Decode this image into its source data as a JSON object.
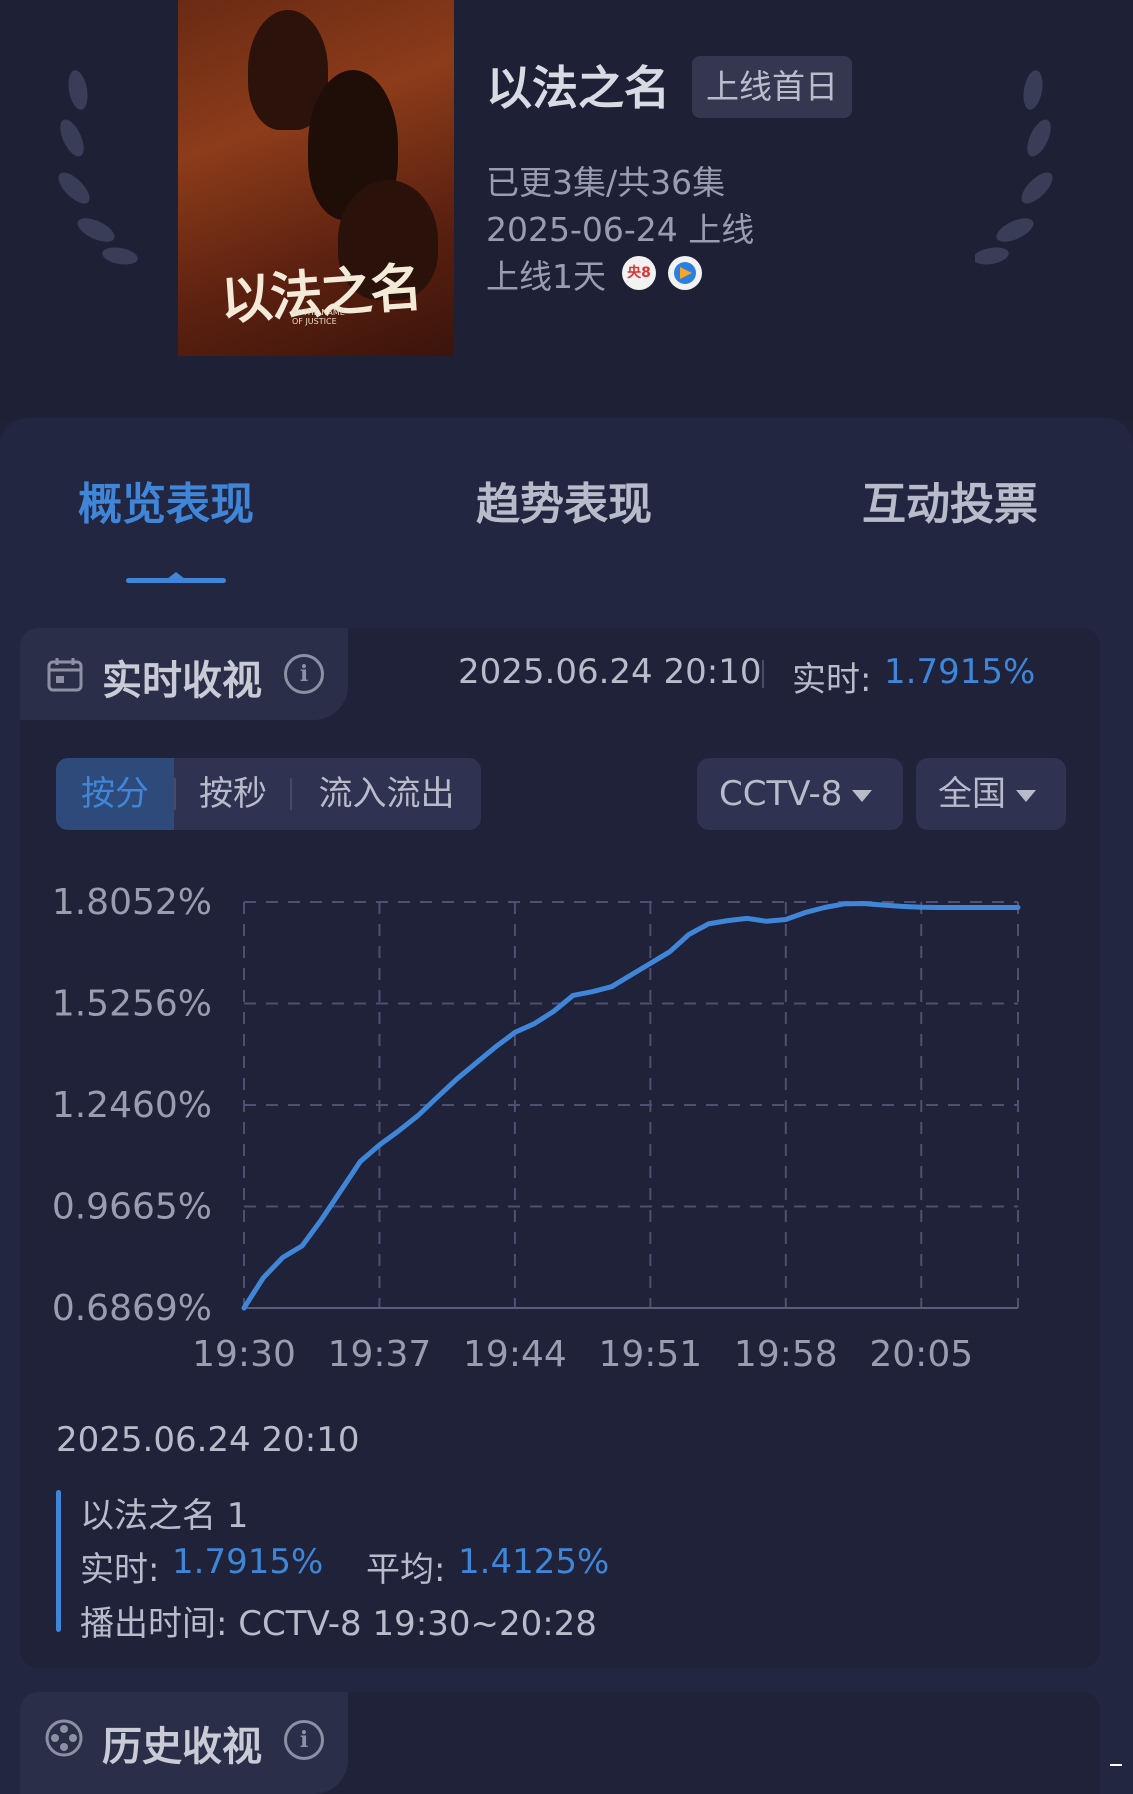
{
  "show": {
    "title": "以法之名",
    "badge": "上线首日",
    "episodes": "已更3集/共36集",
    "release": "2025-06-24 上线",
    "days_online": "上线1天",
    "channel_badge": "央8",
    "poster_title": "以法之名",
    "poster_subtitle_1": "IN THE NAME",
    "poster_subtitle_2": "OF JUSTICE"
  },
  "tabs": [
    {
      "label": "概览表现",
      "active": true
    },
    {
      "label": "趋势表现",
      "active": false
    },
    {
      "label": "互动投票",
      "active": false
    }
  ],
  "realtime": {
    "section_title": "实时收视",
    "timestamp": "2025.06.24 20:10",
    "live_label": "实时:",
    "live_value": "1.7915%",
    "segments": [
      "按分",
      "按秒",
      "流入流出"
    ],
    "channel_select": "CCTV-8",
    "region_select": "全国"
  },
  "chart_data": {
    "type": "line",
    "x_ticks": [
      "19:30",
      "19:37",
      "19:44",
      "19:51",
      "19:58",
      "20:05"
    ],
    "y_ticks": [
      "1.8052%",
      "1.5256%",
      "1.2460%",
      "0.9665%",
      "0.6869%"
    ],
    "ylim": [
      0.6869,
      1.8052
    ],
    "xlim_minutes_from_1930": [
      0,
      40
    ],
    "grid": true,
    "line_color": "#3f86d8",
    "series": [
      {
        "x": [
          0,
          1,
          2,
          3,
          4,
          5,
          6,
          7,
          8,
          9,
          10,
          11,
          12,
          13,
          14,
          15,
          16,
          17,
          18,
          19,
          20,
          21,
          22,
          23,
          24,
          25,
          26,
          27,
          28,
          29,
          30,
          31,
          32,
          33,
          34,
          35,
          36,
          37,
          38,
          39,
          40
        ],
        "values": [
          0.6869,
          0.77,
          0.826,
          0.858,
          0.93,
          1.01,
          1.09,
          1.136,
          1.175,
          1.217,
          1.268,
          1.318,
          1.362,
          1.406,
          1.446,
          1.47,
          1.504,
          1.548,
          1.558,
          1.572,
          1.604,
          1.636,
          1.668,
          1.716,
          1.745,
          1.754,
          1.76,
          1.752,
          1.757,
          1.776,
          1.79,
          1.8,
          1.801,
          1.797,
          1.793,
          1.791,
          1.79,
          1.79,
          1.79,
          1.79,
          1.79
        ]
      }
    ]
  },
  "tooltip": {
    "timestamp": "2025.06.24 20:10",
    "episode": "以法之名 1",
    "live_label": "实时:",
    "live_value": "1.7915%",
    "avg_label": "平均:",
    "avg_value": "1.4125%",
    "broadcast": "播出时间:  CCTV-8 19:30~20:28"
  },
  "history": {
    "section_title": "历史收视"
  }
}
